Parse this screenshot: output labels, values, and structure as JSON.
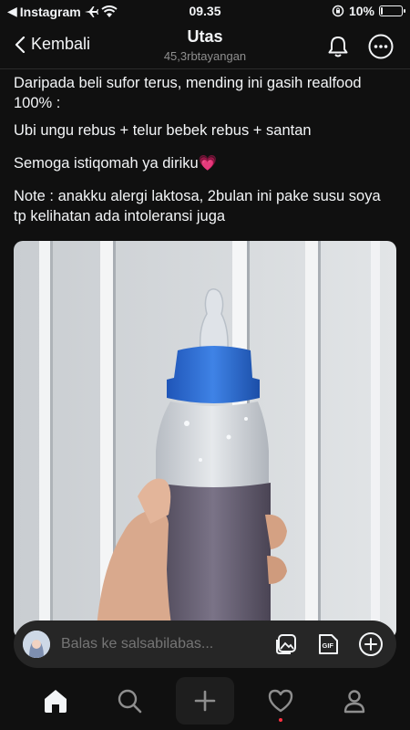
{
  "status": {
    "back_app": "Instagram",
    "time": "09.35",
    "battery_text": "10%",
    "battery_level": 0.1
  },
  "header": {
    "back_label": "Kembali",
    "title": "Utas",
    "subtitle": "45,3rbtayangan"
  },
  "post": {
    "paragraph1": "Daripada beli sufor terus, mending ini gasih realfood 100% :",
    "paragraph2": "Ubi ungu rebus + telur bebek rebus + santan",
    "paragraph3": "Semoga istiqomah ya diriku",
    "paragraph3_emoji": "💗",
    "paragraph4": "Note : anakku alergi laktosa, 2bulan ini pake susu soya tp kelihatan ada intoleransi juga"
  },
  "reply": {
    "placeholder": "Balas ke salsabilabas..."
  },
  "icons": {
    "airplane": "airplane-icon",
    "wifi": "wifi-icon",
    "notifications": "bell-icon",
    "more": "more-icon",
    "image": "image-icon",
    "gif": "gif-icon",
    "add": "plus-circle-icon"
  },
  "colors": {
    "background": "#101010",
    "text": "#f3f5f7",
    "muted": "#8e8e8e",
    "notification_dot": "#ff3040",
    "bottle_cap": "#2f6fd6",
    "milk": "#6b6577"
  }
}
